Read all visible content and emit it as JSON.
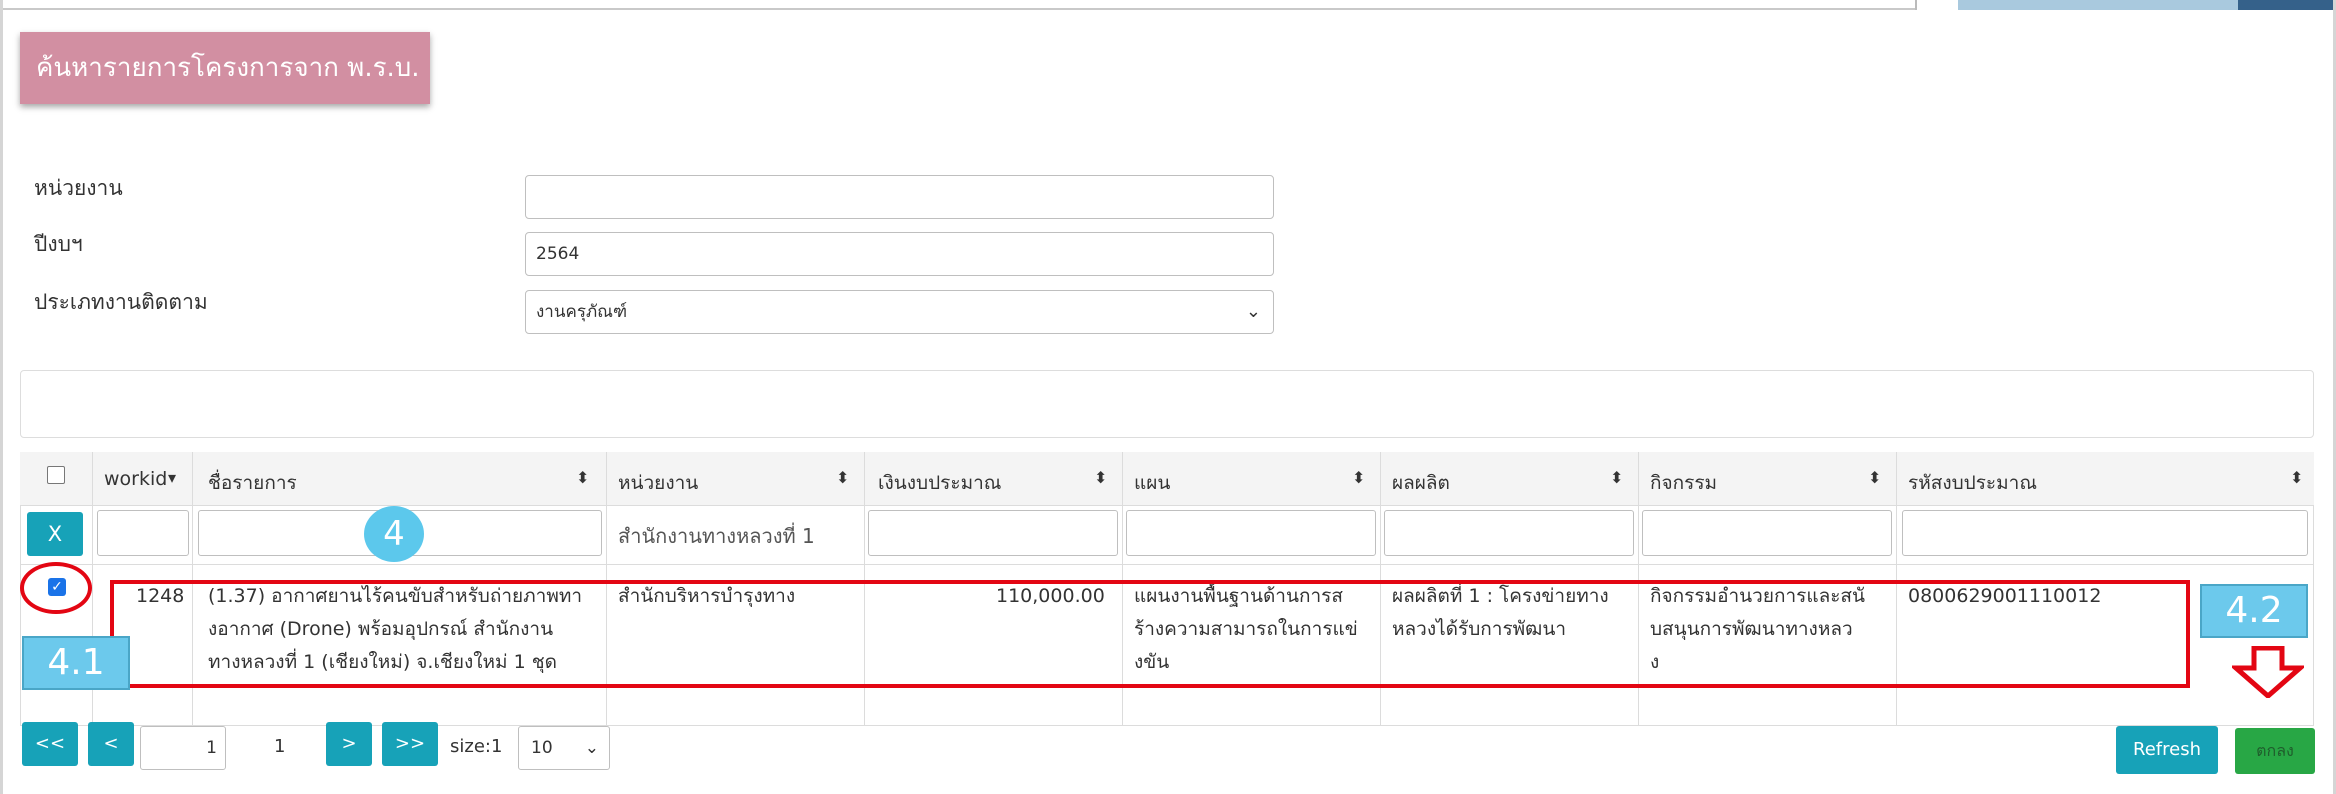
{
  "page": {
    "title": "ค้นหารายการโครงการจาก พ.ร.บ."
  },
  "form": {
    "unit_label": "หน่วยงาน",
    "unit_value": "",
    "year_label": "ปีงบฯ",
    "year_value": "2564",
    "type_label": "ประเภทงานติดตาม",
    "type_value": "งานครุภัณฑ์"
  },
  "table": {
    "headers": {
      "workid": "workid",
      "name": "ชื่อรายการ",
      "unit": "หน่วยงาน",
      "budget": "เงินงบประมาณ",
      "plan": "แผน",
      "output": "ผลผลิต",
      "activity": "กิจกรรม",
      "budget_code": "รหัสงบประมาณ"
    },
    "filter": {
      "clear_label": "X",
      "unit_value": "สำนักงานทางหลวงที่ 1"
    },
    "rows": [
      {
        "checked": true,
        "workid": "1248",
        "name_lines": [
          "(1.37) อากาศยานไร้คนขับสำหรับถ่ายภาพทา",
          "งอากาศ (Drone) พร้อมอุปกรณ์ สำนักงาน",
          "ทางหลวงที่ 1 (เชียงใหม่) จ.เชียงใหม่ 1 ชุด"
        ],
        "unit": "สำนักบริหารบำรุงทาง",
        "budget": "110,000.00",
        "plan_lines": [
          "แผนงานพื้นฐานด้านการส",
          "ร้างความสามารถในการแข่",
          "งขัน"
        ],
        "output_lines": [
          "ผลผลิตที่ 1 : โครงข่ายทาง",
          "หลวงได้รับการพัฒนา"
        ],
        "activity_lines": [
          "กิจกรรมอำนวยการและสนั",
          "บสนุนการพัฒนาทางหลว",
          "ง"
        ],
        "budget_code": "0800629001110012"
      }
    ]
  },
  "pager": {
    "first": "<<",
    "prev": "<",
    "page_input": "1",
    "page_text": "1",
    "next": ">",
    "last": ">>",
    "size_label": "size:1",
    "size_value": "10"
  },
  "actions": {
    "refresh": "Refresh",
    "ok": "ตกลง"
  },
  "annotations": {
    "step": "4",
    "step_select": "4.1",
    "step_confirm": "4.2"
  },
  "colors": {
    "title_bg": "#d28fa2",
    "accent": "#17a2b8",
    "ok": "#28a745",
    "highlight": "#e30613",
    "annotation": "#6cc9ec"
  }
}
